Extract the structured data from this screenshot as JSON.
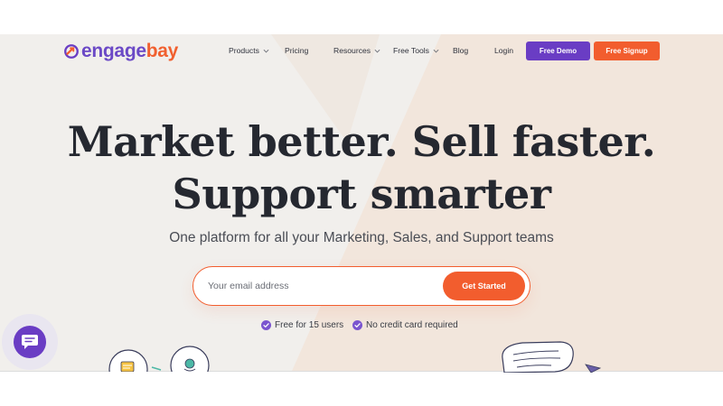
{
  "brand": {
    "logo_part1": "engage",
    "logo_part2": "bay",
    "colors": {
      "purple": "#6a3dc4",
      "orange": "#f25d2e"
    }
  },
  "nav": {
    "items": [
      {
        "label": "Products",
        "has_dropdown": true
      },
      {
        "label": "Pricing",
        "has_dropdown": false
      },
      {
        "label": "Resources",
        "has_dropdown": true
      },
      {
        "label": "Free Tools",
        "has_dropdown": true
      },
      {
        "label": "Blog",
        "has_dropdown": false
      },
      {
        "label": "Login",
        "has_dropdown": false
      }
    ],
    "demo_button": "Free Demo",
    "signup_button": "Free Signup"
  },
  "hero": {
    "title_line1": "Market better. Sell faster.",
    "title_line2": "Support smarter",
    "subtitle": "One platform for all your Marketing, Sales, and Support teams",
    "email_placeholder": "Your email address",
    "cta_button": "Get Started",
    "perks": [
      "Free for 15 users",
      "No credit card required"
    ]
  },
  "icons": {
    "chat": "chat-bubble-icon",
    "check": "check-circle-icon",
    "chevron": "chevron-down-icon"
  }
}
